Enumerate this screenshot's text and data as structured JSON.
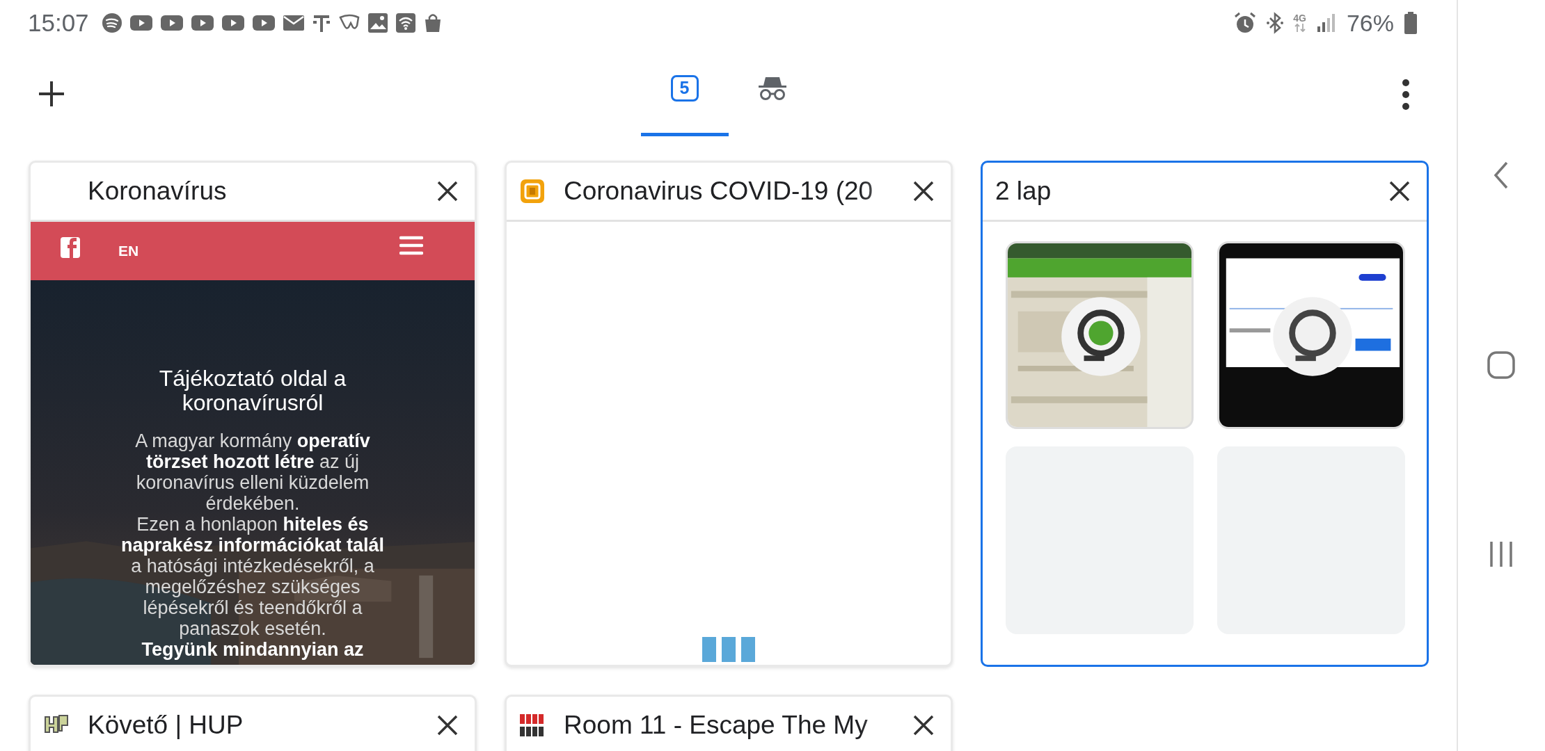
{
  "status_bar": {
    "time": "15:07",
    "network": "4G",
    "battery": "76%"
  },
  "toolbar": {
    "tabs": [
      {
        "kind": "normal",
        "count": "5",
        "selected": true
      },
      {
        "kind": "incognito",
        "selected": false
      }
    ]
  },
  "tab_cards": [
    {
      "kind": "page",
      "title": "Koronavírus",
      "selected": false,
      "page": {
        "nav_label": "EN",
        "heading": "Tájékoztató oldal a koronavírusról",
        "paragraphs": [
          "A magyar kormány **operatív törzset hozott létre** az új koronavírus elleni küzdelem érdekében.",
          "Ezen a honlapon **hiteles és naprakész információkat talál** a hatósági intézkedésekről, a megelőzéshez szükséges lépésekről és teendőkről a panaszok esetén.",
          "**Tegyünk mindannyian az**"
        ]
      }
    },
    {
      "kind": "loading",
      "favicon": {
        "kind": "square"
      },
      "title": "Coronavirus COVID-19 (20",
      "selected": false
    },
    {
      "kind": "group",
      "title": "2 lap",
      "selected": true,
      "thumbs": [
        {
          "kind": "picture"
        },
        {
          "kind": "picture"
        },
        {
          "kind": "empty"
        },
        {
          "kind": "empty"
        }
      ]
    },
    {
      "kind": "page",
      "favicon": {
        "kind": "outline"
      },
      "title": "Követő | HUP",
      "selected": false
    },
    {
      "kind": "page",
      "favicon": {
        "kind": "grid"
      },
      "title": "Room 11 - Escape The My",
      "selected": false
    }
  ]
}
